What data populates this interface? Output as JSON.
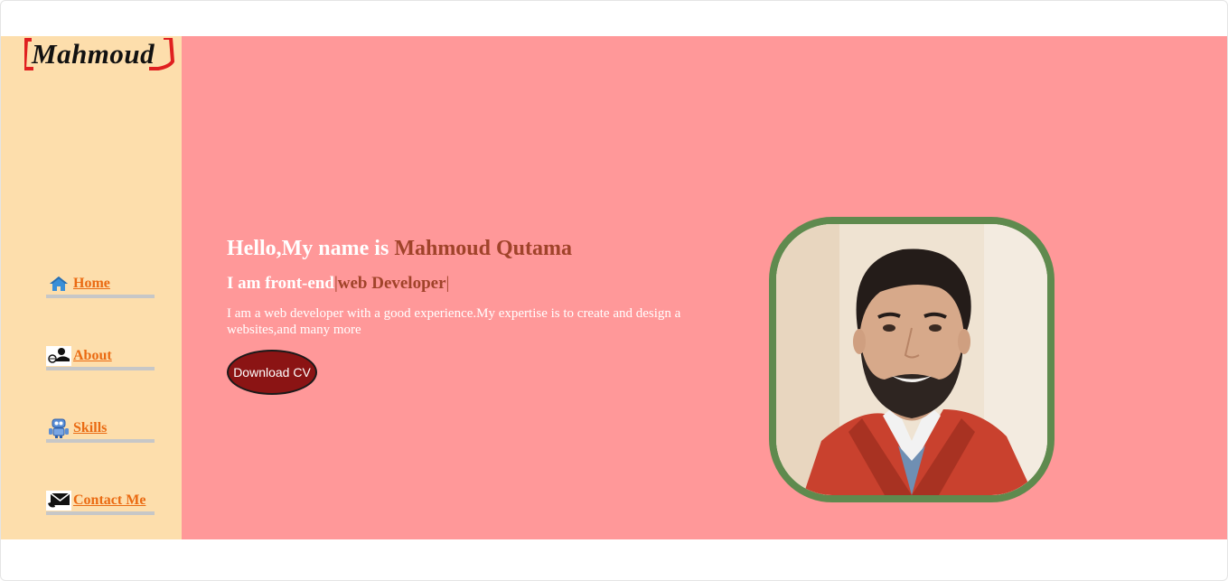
{
  "logo": {
    "text": "Mahmoud"
  },
  "sidebar": {
    "items": [
      {
        "label": "Home",
        "icon": "home-icon"
      },
      {
        "label": "About",
        "icon": "person-icon"
      },
      {
        "label": "Skills",
        "icon": "robot-icon"
      },
      {
        "label": "Contact Me",
        "icon": "envelope-icon"
      }
    ]
  },
  "hero": {
    "greeting": "Hello,My name is ",
    "name": "Mahmoud Qutama",
    "role_prefix": "I am front-end",
    "role_cursor": "|",
    "role_typed": "web Developer",
    "role_cursor_end": "|",
    "description": "I am a web developer with a good experience.My expertise is to create and design a websites,and many more",
    "cv_button": "Download CV"
  },
  "colors": {
    "sidebar_bg": "#fddeac",
    "main_bg": "#ff9899",
    "accent_name": "#a0432a",
    "nav_link": "#ea6a12",
    "button_bg": "#8b1414",
    "portrait_border": "#5f8a4e"
  }
}
